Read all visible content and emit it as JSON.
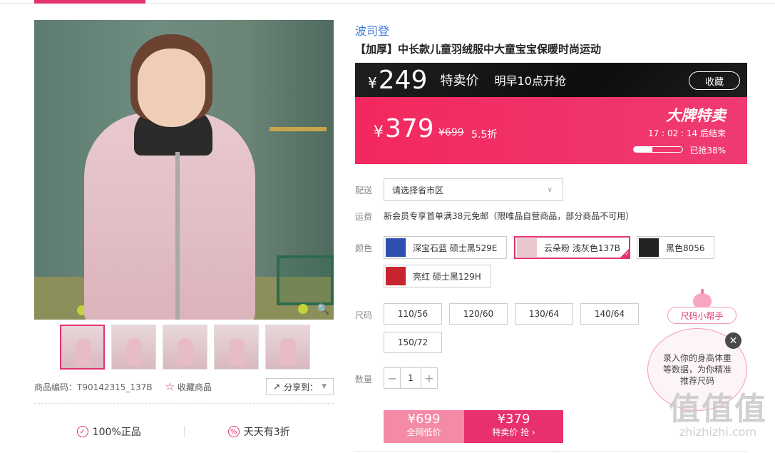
{
  "product": {
    "brand": "波司登",
    "title": "【加厚】中长款儿童羽绒服中大童宝宝保暖时尚运动",
    "sku_label": "商品编码：T90142315_137B",
    "favorite_label": "收藏商品",
    "share_label": "分享到：",
    "thumbnails_count": 5
  },
  "guarantees": [
    {
      "label": "100%正品",
      "icon": "shield-check-icon"
    },
    {
      "label": "天天有3折",
      "icon": "percent-circle-icon"
    }
  ],
  "price_bar": {
    "currency": "¥",
    "upcoming_price": "249",
    "tag": "特卖价",
    "start_text": "明早10点开抢",
    "collect_label": "收藏"
  },
  "sale_bar": {
    "currency": "¥",
    "current_price": "379",
    "original_price": "¥699",
    "discount": "5.5折",
    "event_title": "大牌特卖",
    "countdown": "17 : 02 : 14  后结束",
    "sold_fraction": 0.38,
    "sold_text": "已抢38%"
  },
  "delivery": {
    "label": "配送",
    "select_value": "请选择省市区"
  },
  "freight": {
    "label": "运费",
    "text": "新会员专享首单满38元免邮（限唯品自营商品，部分商品不可用）"
  },
  "colors": {
    "label": "颜色",
    "options": [
      {
        "name": "深宝石蓝 硕士黑529E",
        "swatch": "#2d4fb0"
      },
      {
        "name": "云朵粉 浅灰色137B",
        "swatch": "#e8c7cf",
        "selected": true
      },
      {
        "name": "黑色8056",
        "swatch": "#222222"
      },
      {
        "name": "亮红 硕士黑129H",
        "swatch": "#c8242f"
      }
    ]
  },
  "sizes": {
    "label": "尺码",
    "options": [
      "110/56",
      "120/60",
      "130/64",
      "140/64",
      "150/72"
    ]
  },
  "quantity": {
    "label": "数量",
    "value": "1",
    "minus": "−",
    "plus": "+"
  },
  "buy_buttons": {
    "low_price": "¥699",
    "low_label": "全网低价",
    "sale_price": "¥379",
    "sale_label": "特卖价 抢 ›"
  },
  "size_helper": {
    "tag": "尺码小帮手",
    "bubble_text": "录入你的身高体重等数据，为你精准推荐尺码",
    "close": "✕"
  },
  "watermark": {
    "big": "值值值",
    "small": "zhizhizhi.com"
  },
  "colors_theme": {
    "accent": "#e2336f",
    "brand_link": "#3e7ad3"
  }
}
